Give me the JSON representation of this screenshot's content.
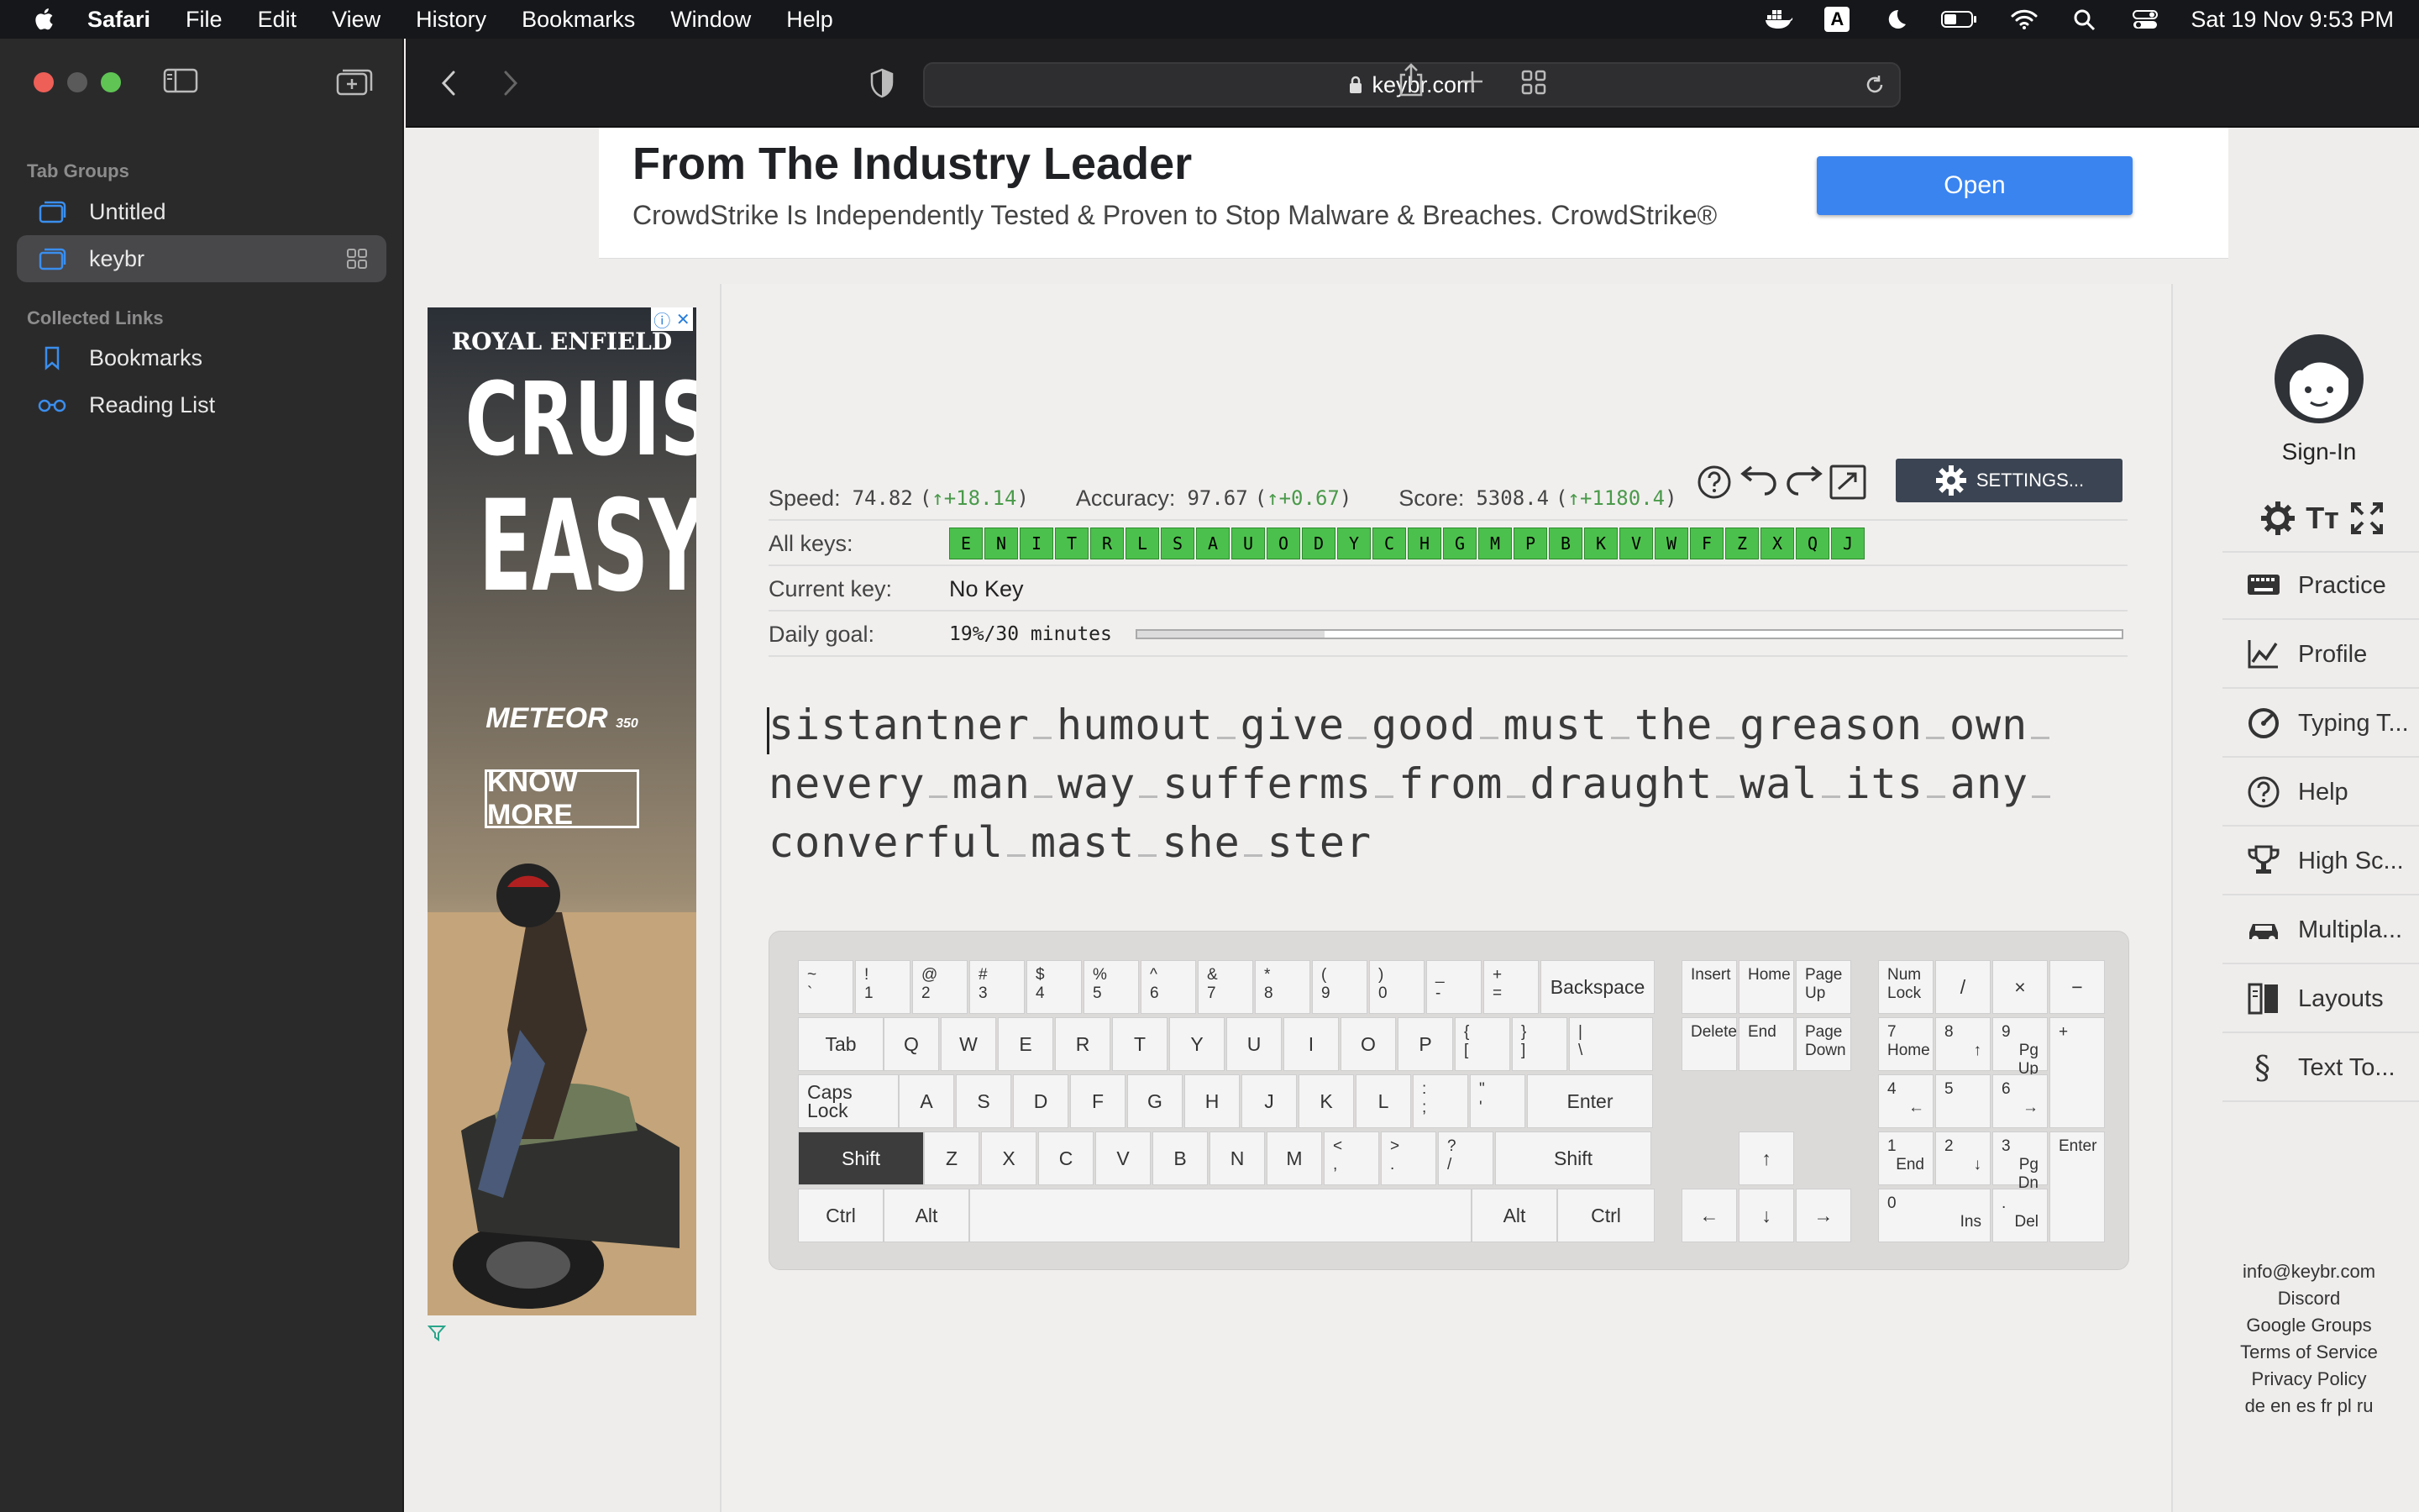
{
  "menubar": {
    "app": "Safari",
    "items": [
      "File",
      "Edit",
      "View",
      "History",
      "Bookmarks",
      "Window",
      "Help"
    ],
    "datetime": "Sat 19 Nov  9:53 PM",
    "input_letter": "A"
  },
  "sidebar": {
    "tab_groups_heading": "Tab Groups",
    "groups": [
      {
        "label": "Untitled",
        "selected": false
      },
      {
        "label": "keybr",
        "selected": true
      }
    ],
    "collected_heading": "Collected Links",
    "links": [
      {
        "label": "Bookmarks",
        "icon": "bookmark-icon"
      },
      {
        "label": "Reading List",
        "icon": "reading-list-icon"
      }
    ]
  },
  "toolbar": {
    "url": "keybr.com"
  },
  "top_ad": {
    "headline": "From The Industry Leader",
    "body": "CrowdStrike Is Independently Tested & Proven to Stop Malware & Breaches. CrowdStrike®",
    "button": "Open"
  },
  "left_ad": {
    "brand": "ROYAL ENFIELD",
    "line1": "CRUISE",
    "line2": "EASY",
    "model": "METEOR",
    "model_sub": "350",
    "cta": "KNOW MORE"
  },
  "stats": {
    "speed_label": "Speed:",
    "speed": "74.82",
    "speed_delta": "↑+18.14",
    "accuracy_label": "Accuracy:",
    "accuracy": "97.67",
    "accuracy_delta": "↑+0.67",
    "score_label": "Score:",
    "score": "5308.4",
    "score_delta": "↑+1180.4"
  },
  "settings_button": "SETTINGS...",
  "all_keys_label": "All keys:",
  "all_keys": [
    "E",
    "N",
    "I",
    "T",
    "R",
    "L",
    "S",
    "A",
    "U",
    "O",
    "D",
    "Y",
    "C",
    "H",
    "G",
    "M",
    "P",
    "B",
    "K",
    "V",
    "W",
    "F",
    "Z",
    "X",
    "Q",
    "J"
  ],
  "current_key_label": "Current key:",
  "current_key": "No Key",
  "daily_goal_label": "Daily goal:",
  "daily_goal": "19%/30 minutes",
  "daily_goal_progress": 0.19,
  "typing_words": [
    "sistantner",
    "humout",
    "give",
    "good",
    "must",
    "the",
    "greason",
    "own",
    "nevery",
    "man",
    "way",
    "sufferms",
    "from",
    "draught",
    "wal",
    "its",
    "any",
    "converful",
    "mast",
    "she",
    "ster"
  ],
  "keyboard": {
    "numrow": [
      [
        "~",
        "`"
      ],
      [
        "!",
        "1"
      ],
      [
        "@",
        "2"
      ],
      [
        "#",
        "3"
      ],
      [
        "$",
        "4"
      ],
      [
        "%",
        "5"
      ],
      [
        "^",
        "6"
      ],
      [
        "&",
        "7"
      ],
      [
        "*",
        "8"
      ],
      [
        "(",
        "9"
      ],
      [
        ")",
        "0"
      ],
      [
        "_",
        "-"
      ],
      [
        "+",
        "="
      ]
    ],
    "backspace": "Backspace",
    "tab": "Tab",
    "qrow": [
      "Q",
      "W",
      "E",
      "R",
      "T",
      "Y",
      "U",
      "I",
      "O",
      "P"
    ],
    "qrow_sym": [
      [
        "{",
        "["
      ],
      [
        "}",
        "]"
      ],
      [
        "|",
        "\\"
      ]
    ],
    "caps": "Caps Lock",
    "arow": [
      "A",
      "S",
      "D",
      "F",
      "G",
      "H",
      "J",
      "K",
      "L"
    ],
    "arow_sym": [
      [
        ":",
        ";"
      ],
      [
        "\"",
        "'"
      ]
    ],
    "enter": "Enter",
    "shift": "Shift",
    "zrow": [
      "Z",
      "X",
      "C",
      "V",
      "B",
      "N",
      "M"
    ],
    "zrow_sym": [
      [
        "<",
        ","
      ],
      [
        ">",
        "."
      ],
      [
        "?",
        "/"
      ]
    ],
    "ctrl": "Ctrl",
    "alt": "Alt",
    "nav": {
      "insert": "Insert",
      "home": "Home",
      "pgup": "Page Up",
      "delete": "Delete",
      "end": "End",
      "pgdn": "Page Down"
    },
    "arrows": {
      "up": "↑",
      "left": "←",
      "down": "↓",
      "right": "→"
    },
    "numpad": {
      "numlock": "Num Lock",
      "div": "/",
      "mul": "×",
      "minus": "−",
      "plus": "+",
      "enter": "Enter",
      "n7": [
        "7",
        "Home"
      ],
      "n8": [
        "8",
        "↑"
      ],
      "n9": [
        "9",
        "Pg Up"
      ],
      "n4": [
        "4",
        "←"
      ],
      "n5": [
        "5",
        ""
      ],
      "n6": [
        "6",
        "→"
      ],
      "n1": [
        "1",
        "End"
      ],
      "n2": [
        "2",
        "↓"
      ],
      "n3": [
        "3",
        "Pg Dn"
      ],
      "n0": [
        "0",
        "Ins"
      ],
      "dot": [
        ".",
        "Del"
      ]
    }
  },
  "right_sidebar": {
    "sign_in": "Sign-In",
    "nav": [
      {
        "label": "Practice",
        "icon": "keyboard-icon"
      },
      {
        "label": "Profile",
        "icon": "chart-icon"
      },
      {
        "label": "Typing T...",
        "icon": "gauge-icon"
      },
      {
        "label": "Help",
        "icon": "help-icon"
      },
      {
        "label": "High Sc...",
        "icon": "trophy-icon"
      },
      {
        "label": "Multipla...",
        "icon": "car-icon"
      },
      {
        "label": "Layouts",
        "icon": "layouts-icon"
      },
      {
        "label": "Text To...",
        "icon": "section-icon"
      }
    ],
    "footer": [
      "info@keybr.com",
      "Discord",
      "Google Groups",
      "Terms of Service",
      "Privacy Policy",
      "de en es fr pl ru"
    ]
  }
}
